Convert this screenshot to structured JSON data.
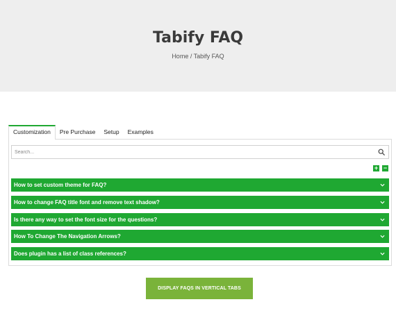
{
  "hero": {
    "title": "Tabify FAQ",
    "breadcrumb": "Home / Tabify FAQ"
  },
  "tabs": [
    {
      "label": "Customization",
      "active": true
    },
    {
      "label": "Pre Purchase",
      "active": false
    },
    {
      "label": "Setup",
      "active": false
    },
    {
      "label": "Examples",
      "active": false
    }
  ],
  "search": {
    "placeholder": "Search...",
    "value": "",
    "icon": "search-icon"
  },
  "controls": {
    "expand_label": "+",
    "collapse_label": "−"
  },
  "faqs": [
    {
      "question": "How to set custom theme for FAQ?",
      "icon": "chevron-down-icon"
    },
    {
      "question": "How to change FAQ title font and remove text shadow?",
      "icon": "chevron-down-icon"
    },
    {
      "question": "Is there any way to set the font size for the questions?",
      "icon": "chevron-down-icon"
    },
    {
      "question": "How To Change The Navigation Arrows?",
      "icon": "chevron-down-icon"
    },
    {
      "question": "Does plugin has a list of class references?",
      "icon": "chevron-down-icon"
    }
  ],
  "cta": {
    "label": "DISPLAY FAQS IN VERTICAL TABS"
  },
  "colors": {
    "accent": "#1fa832",
    "cta": "#7ab33a",
    "hero_bg": "#eeeeee"
  }
}
